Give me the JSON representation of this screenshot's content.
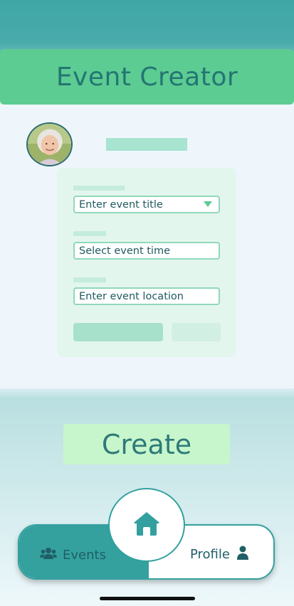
{
  "header": {
    "title": "Event Creator"
  },
  "form": {
    "title_placeholder": "Enter event title",
    "time_placeholder": "Select event time",
    "location_placeholder": "Enter event location"
  },
  "create_button": {
    "label": "Create"
  },
  "nav": {
    "events_label": "Events",
    "profile_label": "Profile",
    "home_icon": "home-icon",
    "events_icon": "users-icon",
    "profile_icon": "user-icon"
  },
  "colors": {
    "header_bg": "#5ccc92",
    "header_text": "#257574",
    "accent_teal": "#35a19f",
    "create_bg": "#c7f6cd",
    "field_border": "#8fd9b9"
  }
}
